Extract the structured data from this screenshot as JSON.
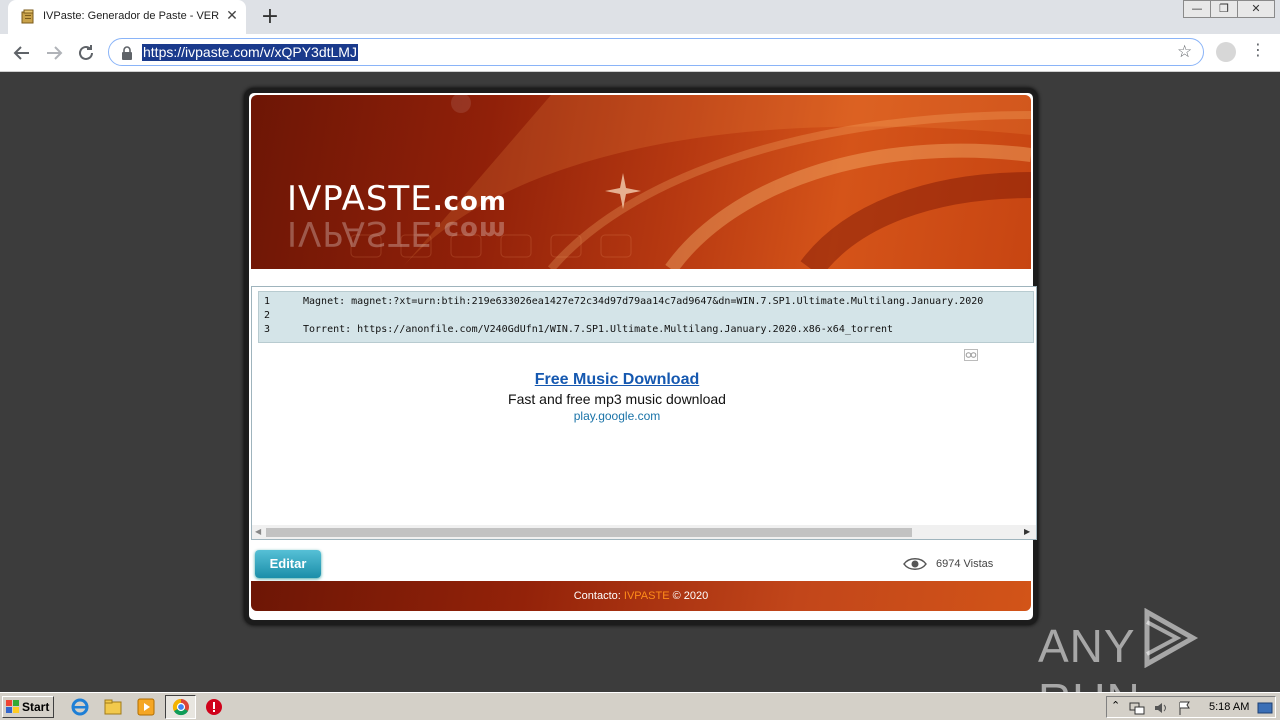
{
  "browser": {
    "tab_title": "IVPaste: Generador de Paste - VER",
    "tab_close": "✕",
    "new_tab": "+",
    "url": "https://ivpaste.com/v/xQPY3dtLMJ",
    "window_controls": {
      "minimize": "—",
      "restore": "❐",
      "close": "✕"
    }
  },
  "site": {
    "logo_main": "IVPASTE",
    "logo_domain": ".com"
  },
  "paste": {
    "lines": [
      {
        "number": "1",
        "text": "Magnet: magnet:?xt=urn:btih:219e633026ea1427e72c34d97d79aa14c7ad9647&dn=WIN.7.SP1.Ultimate.Multilang.January.2020"
      },
      {
        "number": "2",
        "text": ""
      },
      {
        "number": "3",
        "text": "Torrent: https://anonfile.com/V240GdUfn1/WIN.7.SP1.Ultimate.Multilang.January.2020.x86-x64_torrent"
      }
    ]
  },
  "ad": {
    "title": "Free Music Download",
    "description": "Fast and free mp3 music download",
    "url": "play.google.com"
  },
  "actions": {
    "edit_label": "Editar",
    "views_count": "6974",
    "views_label": "Vistas"
  },
  "footer": {
    "contact_label": "Contacto:",
    "contact_link": "IVPASTE",
    "copyright": "© 2020"
  },
  "watermark": {
    "text_left": "ANY",
    "text_right": "RUN"
  },
  "taskbar": {
    "start_label": "Start",
    "clock": "5:18 AM"
  },
  "colors": {
    "accent": "#1b8ea9",
    "banner_dark": "#6d1605",
    "banner_light": "#d55419",
    "link": "#1558b0"
  }
}
